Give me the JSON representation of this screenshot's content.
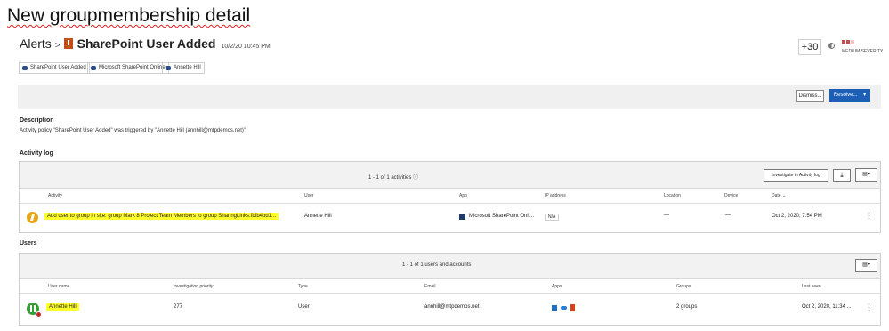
{
  "heading": "New groupmembership detail",
  "breadcrumb": {
    "alerts": "Alerts",
    "separator": ">",
    "alert_name": "SharePoint User Added",
    "timestamp": "10/2/20 10:45 PM"
  },
  "tags": [
    "SharePoint User Added",
    "Microsoft SharePoint Online",
    "Annette Hill"
  ],
  "header_right": {
    "score": "+30",
    "severity": "MEDIUM SEVERITY"
  },
  "actions": {
    "dismiss": "Dismiss...",
    "resolve": "Resolve...",
    "resolve_caret": "▾"
  },
  "description": {
    "label": "Description",
    "text": "Activity policy \"SharePoint User Added\" was triggered by \"Annette Hill (annhill@mtpdemos.net)\""
  },
  "activity_log": {
    "label": "Activity log",
    "count": "1 - 1 of 1 activities ⓘ",
    "investigate_button": "Investigate in Activity log",
    "download_icon": "⤓",
    "columns_icon": "▤▾",
    "columns": [
      "Activity",
      "User",
      "App",
      "IP address",
      "Location",
      "Device",
      "Date ⌄"
    ],
    "row": {
      "activity": "Add user to group in site: group Mark 8 Project Team Members to group SharingLinks.fbfb4bd1...",
      "user": "Annette Hill",
      "app": "Microsoft SharePoint Onli...",
      "ip": "N/A",
      "location": "—",
      "device": "—",
      "date": "Oct 2, 2020, 7:54 PM",
      "menu": "⋮"
    }
  },
  "users": {
    "label": "Users",
    "count": "1 - 1 of 1 users and accounts",
    "columns_icon": "▤▾",
    "columns": [
      "User name",
      "Investigation priority",
      "Type",
      "Email",
      "Apps",
      "Groups",
      "Last seen"
    ],
    "row": {
      "name": "Annette Hill",
      "priority": "277",
      "type": "User",
      "email": "annhill@mtpdemos.net",
      "groups": "2 groups",
      "last_seen": "Oct 2, 2020, 11:34 ...",
      "menu": "⋮"
    }
  },
  "colors": {
    "highlight": "#ffff2b",
    "accent": "#1d5fb5",
    "severity": "#c0504d"
  }
}
